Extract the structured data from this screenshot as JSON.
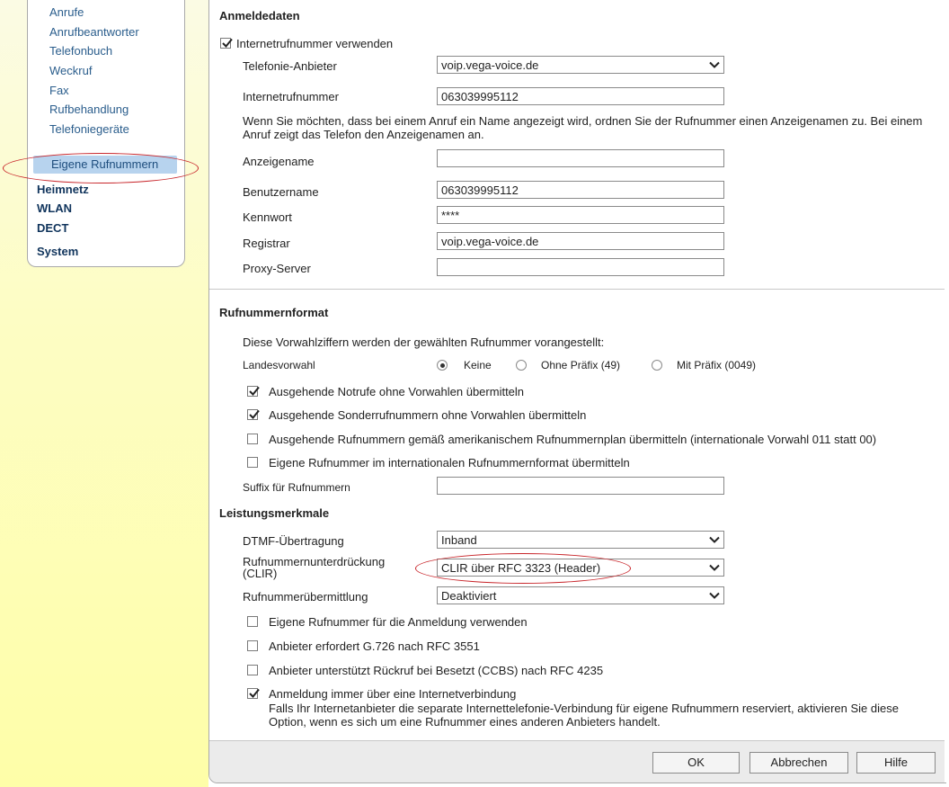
{
  "sidebar": {
    "sub_items": [
      "Anrufe",
      "Anrufbeantworter",
      "Telefonbuch",
      "Weckruf",
      "Fax",
      "Rufbehandlung",
      "Telefoniegeräte"
    ],
    "selected": "Eigene Rufnummern",
    "main_items": [
      "Heimnetz",
      "WLAN",
      "DECT",
      "System"
    ]
  },
  "anmeldedaten": {
    "title": "Anmeldedaten",
    "use_internet_number": "Internetrufnummer verwenden",
    "provider_label": "Telefonie-Anbieter",
    "provider_value": "voip.vega-voice.de",
    "internet_number_label": "Internetrufnummer",
    "internet_number_value": "063039995112",
    "display_hint": "Wenn Sie möchten, dass bei einem Anruf ein Name angezeigt wird, ordnen Sie der Rufnummer einen Anzeigenamen zu. Bei einem Anruf zeigt das Telefon den Anzeigenamen an.",
    "display_name_label": "Anzeigename",
    "display_name_value": "",
    "username_label": "Benutzername",
    "username_value": "063039995112",
    "password_label": "Kennwort",
    "password_value": "****",
    "registrar_label": "Registrar",
    "registrar_value": "voip.vega-voice.de",
    "proxy_label": "Proxy-Server",
    "proxy_value": ""
  },
  "format": {
    "title": "Rufnummernformat",
    "intro": "Diese Vorwahlziffern werden der gewählten Rufnummer vorangestellt:",
    "country_label": "Landesvorwahl",
    "radio_none": "Keine",
    "radio_no_prefix": "Ohne Präfix (49)",
    "radio_prefix": "Mit Präfix (0049)",
    "cb_emergency": "Ausgehende Notrufe ohne Vorwahlen übermitteln",
    "cb_special": "Ausgehende Sonderrufnummern ohne Vorwahlen übermitteln",
    "cb_american": "Ausgehende Rufnummern gemäß amerikanischem Rufnummernplan übermitteln (internationale Vorwahl 011 statt 00)",
    "cb_international": "Eigene Rufnummer im internationalen Rufnummernformat übermitteln",
    "suffix_label": "Suffix für Rufnummern",
    "suffix_value": ""
  },
  "features": {
    "title": "Leistungsmerkmale",
    "dtmf_label": "DTMF-Übertragung",
    "dtmf_value": "Inband",
    "clir_label_1": "Rufnummernunterdrückung",
    "clir_label_2": "(CLIR)",
    "clir_value": "CLIR über RFC 3323 (Header)",
    "clip_label": "Rufnummerübermittlung",
    "clip_value": "Deaktiviert",
    "cb_own_number": "Eigene Rufnummer für die Anmeldung verwenden",
    "cb_g726": "Anbieter erfordert G.726 nach RFC 3551",
    "cb_ccbs": "Anbieter unterstützt Rückruf bei Besetzt (CCBS) nach RFC 4235",
    "cb_always_internet": "Anmeldung immer über eine Internetverbindung",
    "always_internet_hint": "Falls Ihr Internetanbieter die separate Internettelefonie-Verbindung für eigene Rufnummern reserviert, aktivieren Sie diese Option, wenn es sich um eine Rufnummer eines anderen Anbieters handelt."
  },
  "buttons": {
    "ok": "OK",
    "cancel": "Abbrechen",
    "help": "Hilfe"
  },
  "colors": {
    "highlight_ellipse": "#c8262b",
    "selected_bg": "#b7d3ee"
  }
}
